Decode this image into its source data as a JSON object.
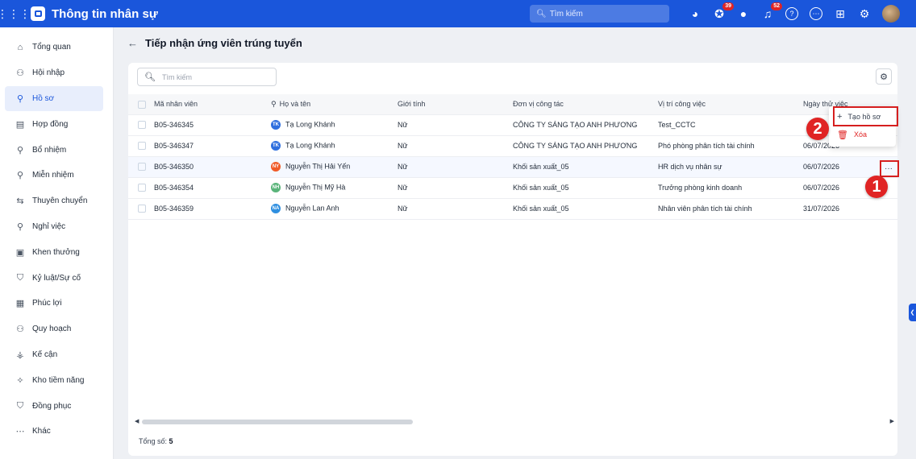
{
  "app": {
    "title": "Thông tin nhân sự",
    "search_placeholder": "Tìm kiếm",
    "badges": {
      "messages": "39",
      "notifications": "52"
    }
  },
  "sidebar": {
    "items": [
      {
        "label": "Tổng quan",
        "icon": "home-icon"
      },
      {
        "label": "Hội nhập",
        "icon": "users-join-icon"
      },
      {
        "label": "Hồ sơ",
        "icon": "user-icon",
        "active": true
      },
      {
        "label": "Hợp đồng",
        "icon": "document-icon"
      },
      {
        "label": "Bổ nhiệm",
        "icon": "user-plus-icon"
      },
      {
        "label": "Miễn nhiệm",
        "icon": "user-minus-icon"
      },
      {
        "label": "Thuyên chuyển",
        "icon": "transfer-icon"
      },
      {
        "label": "Nghỉ việc",
        "icon": "user-leave-icon"
      },
      {
        "label": "Khen thưởng",
        "icon": "reward-icon"
      },
      {
        "label": "Kỷ luật/Sự cố",
        "icon": "shield-icon"
      },
      {
        "label": "Phúc lợi",
        "icon": "gift-icon"
      },
      {
        "label": "Quy hoạch",
        "icon": "plan-icon"
      },
      {
        "label": "Kế cận",
        "icon": "org-chart-icon"
      },
      {
        "label": "Kho tiềm năng",
        "icon": "talent-icon"
      },
      {
        "label": "Đồng phục",
        "icon": "shirt-icon"
      },
      {
        "label": "Khác",
        "icon": "more-icon"
      }
    ]
  },
  "page": {
    "title": "Tiếp nhận ứng viên trúng tuyển",
    "search_placeholder": "Tìm kiếm"
  },
  "table": {
    "columns": [
      "Mã nhân viên",
      "Họ và tên",
      "Giới tính",
      "Đơn vị công tác",
      "Vị trí công việc",
      "Ngày thử việc"
    ],
    "rows": [
      {
        "code": "B05-346345",
        "initials": "TK",
        "avatar_color": "#2f6fde",
        "name": "Tạ Long Khánh",
        "gender": "Nữ",
        "unit": "CÔNG TY SÁNG TẠO ANH PHƯƠNG",
        "position": "Test_CCTC",
        "date": ""
      },
      {
        "code": "B05-346347",
        "initials": "TK",
        "avatar_color": "#2f6fde",
        "name": "Tạ Long Khánh",
        "gender": "Nữ",
        "unit": "CÔNG TY SÁNG TẠO ANH PHƯƠNG",
        "position": "Phó phòng phân tích tài chính",
        "date": "06/07/2026"
      },
      {
        "code": "B05-346350",
        "initials": "NY",
        "avatar_color": "#f05a28",
        "name": "Nguyễn Thị Hải Yến",
        "gender": "Nữ",
        "unit": "Khối sản xuất_05",
        "position": "HR dịch vụ nhân sự",
        "date": "06/07/2026",
        "highlight": true
      },
      {
        "code": "B05-346354",
        "initials": "NH",
        "avatar_color": "#5ab47a",
        "name": "Nguyễn Thị Mỹ Hà",
        "gender": "Nữ",
        "unit": "Khối sản xuất_05",
        "position": "Trưởng phòng kinh doanh",
        "date": "06/07/2026"
      },
      {
        "code": "B05-346359",
        "initials": "NA",
        "avatar_color": "#2f8fe0",
        "name": "Nguyễn Lan Anh",
        "gender": "Nữ",
        "unit": "Khối sản xuất_05",
        "position": "Nhân viên phân tích tài chính",
        "date": "31/07/2026"
      }
    ]
  },
  "footer": {
    "total_label": "Tổng số:",
    "total_value": "5"
  },
  "context_menu": {
    "create": "Tạo hồ sơ",
    "delete": "Xóa"
  },
  "steps": {
    "one": "1",
    "two": "2"
  },
  "colors": {
    "brand": "#1a56db",
    "danger": "#e02424"
  }
}
